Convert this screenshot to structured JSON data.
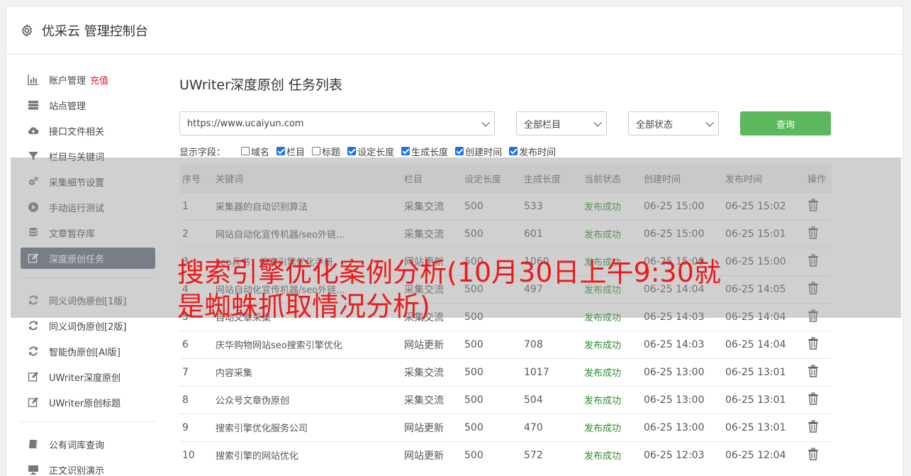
{
  "header": {
    "title": "优采云 管理控制台",
    "icon": "gear-icon"
  },
  "sidebar": {
    "group1": [
      {
        "label": "账户管理",
        "badge": "充值",
        "icon": "bar-chart-icon"
      },
      {
        "label": "站点管理",
        "icon": "server-icon"
      },
      {
        "label": "接口文件相关",
        "icon": "cloud-upload-icon"
      },
      {
        "label": "栏目与关键词",
        "icon": "filter-icon"
      },
      {
        "label": "采集细节设置",
        "icon": "gears-icon"
      },
      {
        "label": "手动运行测试",
        "icon": "play-circle-icon"
      },
      {
        "label": "文章暂存库",
        "icon": "database-icon"
      },
      {
        "label": "深度原创任务",
        "icon": "edit-icon",
        "active": true
      }
    ],
    "group2": [
      {
        "label": "同义词伪原创[1版]",
        "icon": "refresh-icon"
      },
      {
        "label": "同义词伪原创[2版]",
        "icon": "refresh-icon"
      },
      {
        "label": "智能伪原创[AI版]",
        "icon": "refresh-icon"
      },
      {
        "label": "UWriter深度原创",
        "icon": "edit-icon"
      },
      {
        "label": "UWriter原创标题",
        "icon": "edit-icon"
      }
    ],
    "group3": [
      {
        "label": "公有词库查询",
        "icon": "book-icon"
      },
      {
        "label": "正文识别演示",
        "icon": "monitor-icon"
      }
    ]
  },
  "main": {
    "title": "UWriter深度原创 任务列表",
    "site_select": "https://www.ucaiyun.com",
    "column_select": "全部栏目",
    "status_select": "全部状态",
    "query_label": "查询",
    "fields_label": "显示字段：",
    "fields": [
      {
        "label": "域名",
        "checked": false
      },
      {
        "label": "栏目",
        "checked": true
      },
      {
        "label": "标题",
        "checked": false
      },
      {
        "label": "设定长度",
        "checked": true
      },
      {
        "label": "生成长度",
        "checked": true
      },
      {
        "label": "创建时间",
        "checked": true
      },
      {
        "label": "发布时间",
        "checked": true
      }
    ],
    "columns": [
      "序号",
      "关键词",
      "栏目",
      "设定长度",
      "生成长度",
      "当前状态",
      "创建时间",
      "发布时间",
      "操作"
    ],
    "rows": [
      [
        "1",
        "采集器的自动识别算法",
        "采集交流",
        "500",
        "533",
        "发布成功",
        "06-25 15:00",
        "06-25 15:02"
      ],
      [
        "2",
        "网站自动化宣传机器/seo外链...",
        "采集交流",
        "500",
        "601",
        "发布成功",
        "06-25 15:00",
        "06-25 15:01"
      ],
      [
        "3",
        "seo兵书：搜索引擎优化手册",
        "网站更新",
        "500",
        "1060",
        "发布成功",
        "06-25 15:00",
        "06-25 15:00"
      ],
      [
        "4",
        "网站自动化宣传机器/seo外链...",
        "采集交流",
        "500",
        "497",
        "发布成功",
        "06-25 14:04",
        "06-25 14:05"
      ],
      [
        "5",
        "自动文章采集",
        "采集交流",
        "500",
        "",
        "发布成功",
        "06-25 14:03",
        "06-25 14:04"
      ],
      [
        "6",
        "庆华购物网站seo搜索引擎优化",
        "网站更新",
        "500",
        "708",
        "发布成功",
        "06-25 14:03",
        "06-25 14:04"
      ],
      [
        "7",
        "内容采集",
        "采集交流",
        "500",
        "1017",
        "发布成功",
        "06-25 13:00",
        "06-25 13:01"
      ],
      [
        "8",
        "公众号文章伪原创",
        "采集交流",
        "500",
        "504",
        "发布成功",
        "06-25 13:00",
        "06-25 13:01"
      ],
      [
        "9",
        "搜索引擎优化服务公司",
        "网站更新",
        "500",
        "470",
        "发布成功",
        "06-25 13:00",
        "06-25 13:01"
      ],
      [
        "10",
        "搜索引擎的网站优化",
        "网站更新",
        "500",
        "572",
        "发布成功",
        "06-25 12:03",
        "06-25 12:04"
      ]
    ]
  },
  "watermark": "搜索引擎优化案例分析(10月30日上午9:30就是蜘蛛抓取情况分析)"
}
